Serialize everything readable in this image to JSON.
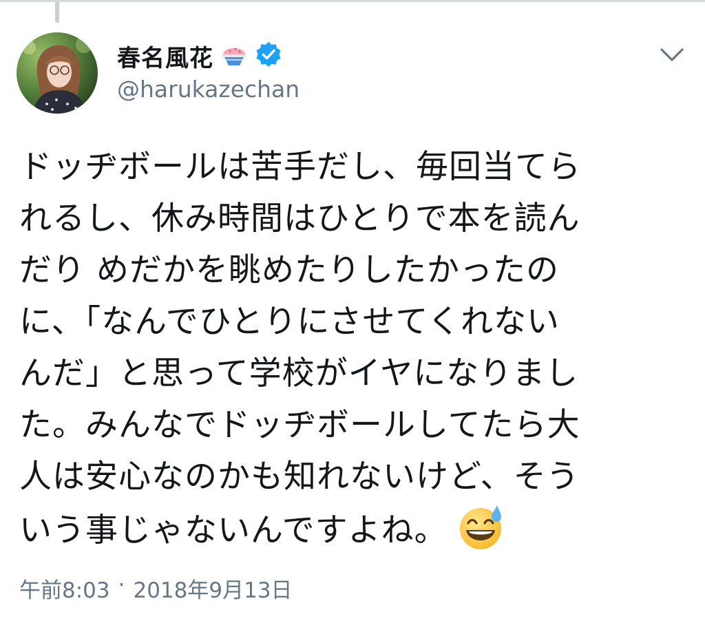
{
  "tweet": {
    "display_name": "春名風花",
    "handle": "@harukazechan",
    "verified": true,
    "name_emoji": "shaved-ice-icon",
    "text_lines": [
      "ドッヂボールは苦手だし、毎回当てら",
      "れるし、休み時間はひとりで本を読ん",
      "だり めだかを眺めたりしたかったの",
      "に、「なんでひとりにさせてくれない",
      "んだ」と思って学校がイヤになりまし",
      "た。みんなでドッヂボールしてたら大",
      "人は安心なのかも知れないけど、そう",
      "いう事じゃないんですよね。"
    ],
    "end_emoji": "grinning-face-with-sweat-icon",
    "time": "午前8:03",
    "separator": "·",
    "date": "2018年9月13日"
  },
  "colors": {
    "text": "#14171a",
    "secondary": "#657786",
    "verified": "#1da1f2",
    "divider": "#d6d9db"
  }
}
